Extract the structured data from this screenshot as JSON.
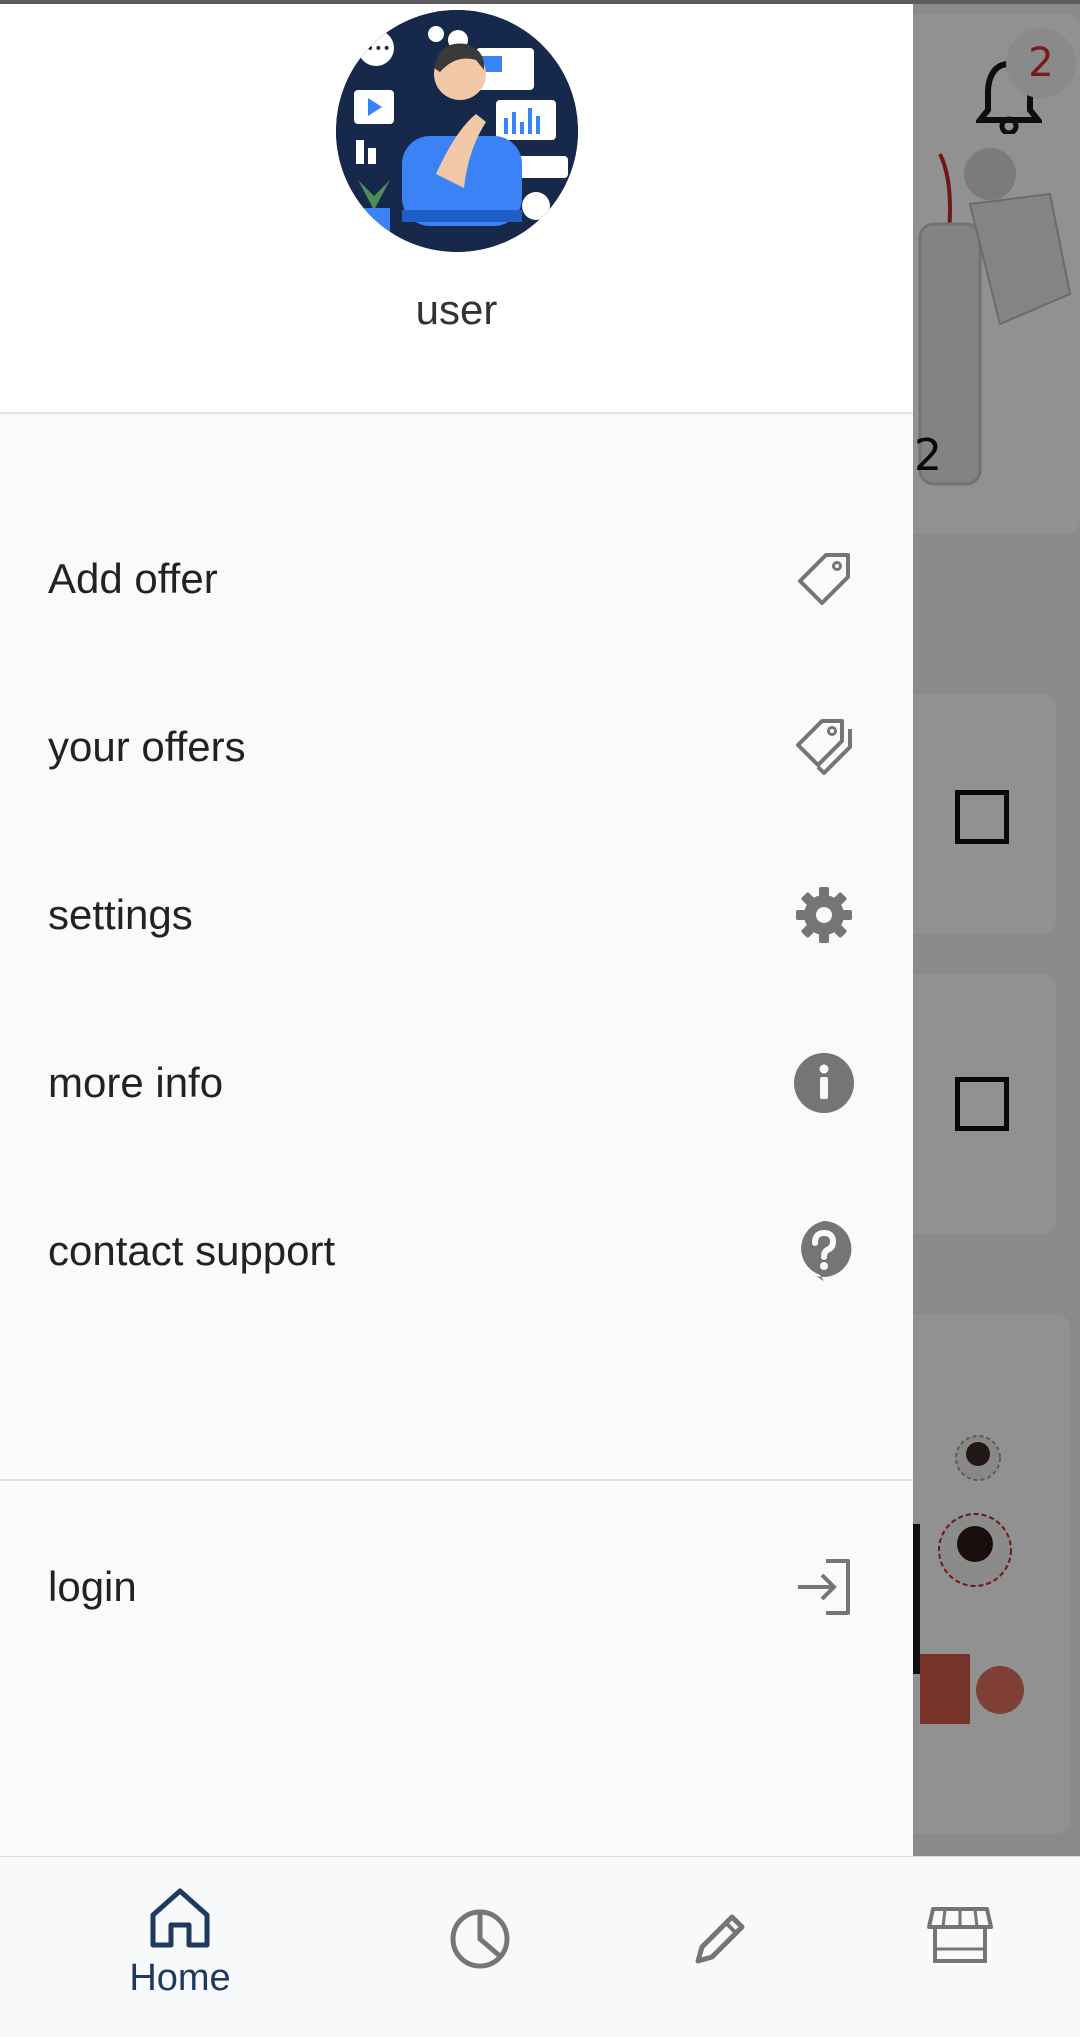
{
  "background": {
    "notification_count": "2",
    "counter_value": "2"
  },
  "drawer": {
    "user_name": "user",
    "menu": [
      {
        "label": "Add offer",
        "icon": "tag-icon"
      },
      {
        "label": "your offers",
        "icon": "tags-icon"
      },
      {
        "label": "settings",
        "icon": "gear-icon"
      },
      {
        "label": "more info",
        "icon": "info-icon"
      },
      {
        "label": "contact support",
        "icon": "help-icon"
      }
    ],
    "login": {
      "label": "login",
      "icon": "login-icon"
    }
  },
  "bottom_nav": {
    "items": [
      {
        "label": "Home",
        "icon": "home-icon",
        "active": true
      },
      {
        "label": "",
        "icon": "pie-chart-icon",
        "active": false
      },
      {
        "label": "",
        "icon": "pencil-icon",
        "active": false
      },
      {
        "label": "",
        "icon": "store-icon",
        "active": false
      }
    ]
  },
  "colors": {
    "accent": "#1f3a60",
    "badge": "#d32f2f",
    "icon_gray": "#757575"
  }
}
